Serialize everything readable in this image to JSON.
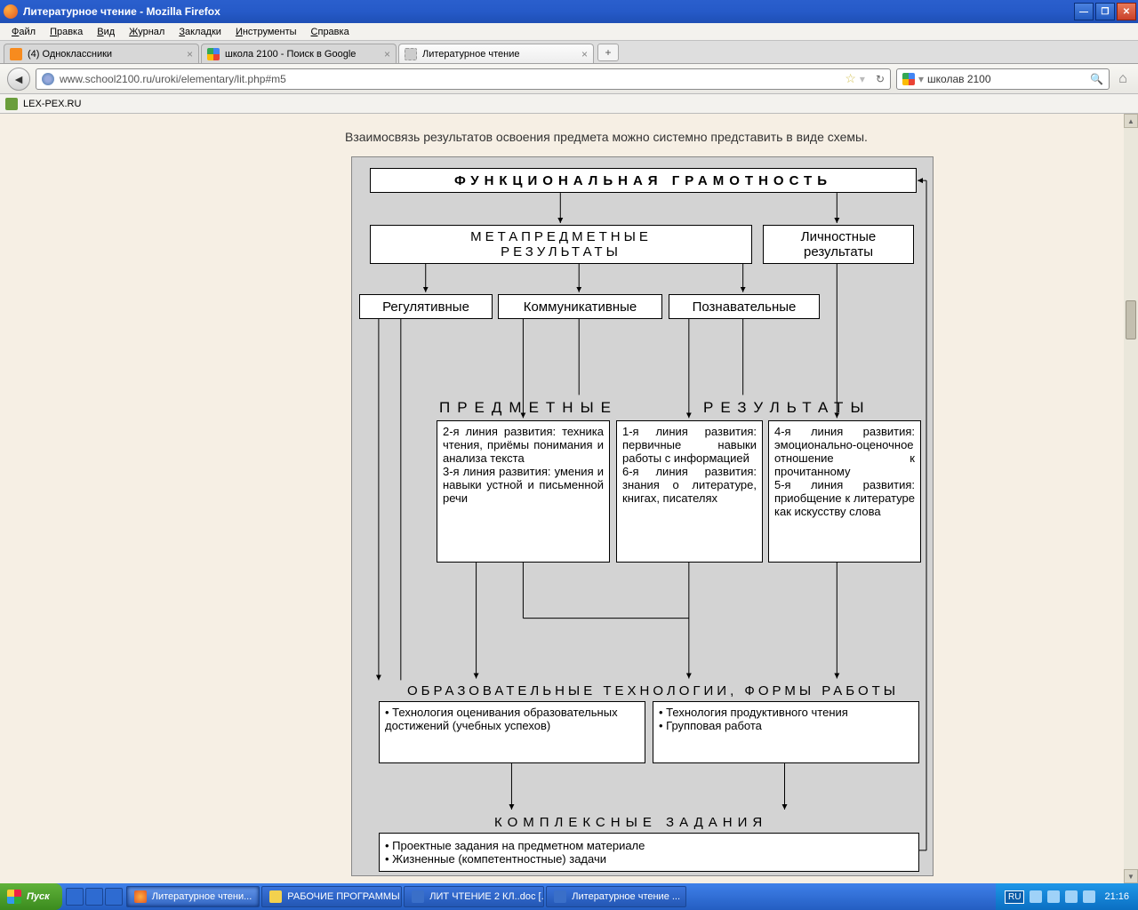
{
  "titlebar": {
    "text": "Литературное чтение - Mozilla Firefox"
  },
  "menu": {
    "file": "Файл",
    "edit": "Правка",
    "view": "Вид",
    "history": "Журнал",
    "bookmarks": "Закладки",
    "tools": "Инструменты",
    "help": "Справка"
  },
  "tabs": [
    {
      "label": "(4) Одноклассники"
    },
    {
      "label": "школа 2100 - Поиск в Google"
    },
    {
      "label": "Литературное чтение"
    }
  ],
  "url": "www.school2100.ru/uroki/elementary/lit.php#m5",
  "search_value": "школав 2100",
  "bookmark": "LEX-PEX.RU",
  "intro": "Взаимосвязь результатов освоения предмета можно системно представить в виде схемы.",
  "diagram": {
    "top": "ФУНКЦИОНАЛЬНАЯ ГРАМОТНОСТЬ",
    "meta": "МЕТАПРЕДМЕТНЫЕ\nРЕЗУЛЬТАТЫ",
    "pers": "Личностные\nрезультаты",
    "reg": "Регулятивные",
    "komm": "Коммуникативные",
    "pozn": "Познавательные",
    "hdr_pred": "ПРЕДМЕТНЫЕ",
    "hdr_rez": "РЕЗУЛЬТАТЫ",
    "p1": "2-я линия развития: техника чтения, приёмы понимания и анализа текста\n3-я линия развития: умения и навыки устной и письменной речи",
    "p2": "1-я линия развития: первичные навыки работы с информацией\n6-я линия развития: знания о литературе, книгах, писателях",
    "p3": "4-я линия развития: эмоционально-оценочное отношение к прочитанному\n5-я линия развития: приобщение к литературе как искусству слова",
    "hdr_tech": "ОБРАЗОВАТЕЛЬНЫЕ ТЕХНОЛОГИИ, ФОРМЫ РАБОТЫ",
    "t1": "• Технология оценивания образовательных достижений (учебных успехов)",
    "t2": "• Технология продуктивного чтения\n• Групповая работа",
    "hdr_komp": "КОМПЛЕКСНЫЕ  ЗАДАНИЯ",
    "k": "• Проектные задания на предметном материале\n• Жизненные (компетентностные) задачи"
  },
  "taskbar": {
    "start": "Пуск",
    "tasks": [
      "Литературное чтени...",
      "РАБОЧИЕ ПРОГРАММЫ ...",
      "ЛИТ ЧТЕНИЕ 2 КЛ..doc [...",
      "Литературное чтение ..."
    ],
    "lang": "RU",
    "time": "21:16"
  }
}
